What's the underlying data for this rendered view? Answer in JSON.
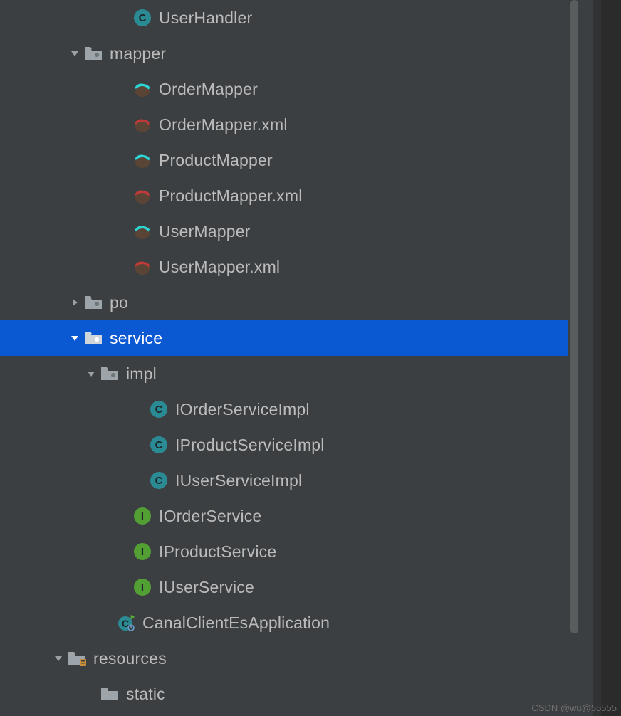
{
  "tree": {
    "rows": [
      {
        "indent": 7,
        "chevron": null,
        "icon": "class",
        "label": "UserHandler"
      },
      {
        "indent": 4,
        "chevron": "down",
        "icon": "folder",
        "label": "mapper"
      },
      {
        "indent": 7,
        "chevron": null,
        "icon": "mybatis-cyan",
        "label": "OrderMapper"
      },
      {
        "indent": 7,
        "chevron": null,
        "icon": "mybatis-red",
        "label": "OrderMapper.xml"
      },
      {
        "indent": 7,
        "chevron": null,
        "icon": "mybatis-cyan",
        "label": "ProductMapper"
      },
      {
        "indent": 7,
        "chevron": null,
        "icon": "mybatis-red",
        "label": "ProductMapper.xml"
      },
      {
        "indent": 7,
        "chevron": null,
        "icon": "mybatis-cyan",
        "label": "UserMapper"
      },
      {
        "indent": 7,
        "chevron": null,
        "icon": "mybatis-red",
        "label": "UserMapper.xml"
      },
      {
        "indent": 4,
        "chevron": "right",
        "icon": "folder",
        "label": "po"
      },
      {
        "indent": 4,
        "chevron": "down",
        "icon": "folder",
        "label": "service",
        "selected": true
      },
      {
        "indent": 5,
        "chevron": "down",
        "icon": "folder",
        "label": "impl"
      },
      {
        "indent": 8,
        "chevron": null,
        "icon": "class",
        "label": "IOrderServiceImpl"
      },
      {
        "indent": 8,
        "chevron": null,
        "icon": "class",
        "label": "IProductServiceImpl"
      },
      {
        "indent": 8,
        "chevron": null,
        "icon": "class",
        "label": "IUserServiceImpl"
      },
      {
        "indent": 7,
        "chevron": null,
        "icon": "interface",
        "label": "IOrderService"
      },
      {
        "indent": 7,
        "chevron": null,
        "icon": "interface",
        "label": "IProductService"
      },
      {
        "indent": 7,
        "chevron": null,
        "icon": "interface",
        "label": "IUserService"
      },
      {
        "indent": 6,
        "chevron": null,
        "icon": "app",
        "label": "CanalClientEsApplication"
      },
      {
        "indent": 3,
        "chevron": "down",
        "icon": "resource-folder",
        "label": "resources"
      },
      {
        "indent": 5,
        "chevron": null,
        "icon": "folder-plain",
        "label": "static"
      }
    ]
  },
  "watermark": "CSDN @wu@55555"
}
